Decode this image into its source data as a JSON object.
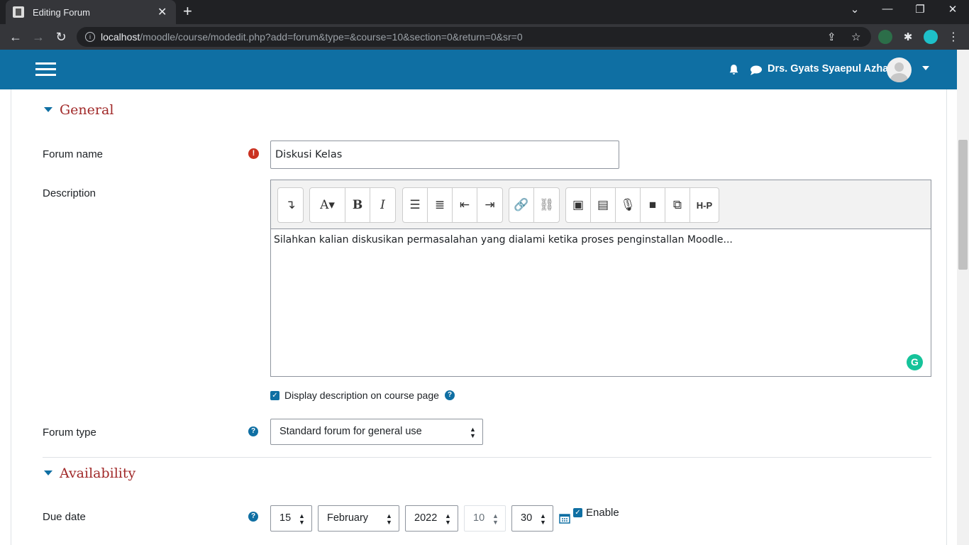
{
  "browser": {
    "tab_title": "Editing Forum",
    "url_host": "localhost",
    "url_path": "/moodle/course/modedit.php?add=forum&type=&course=10&section=0&return=0&sr=0"
  },
  "header": {
    "user_name": "Drs. Gyats Syaepul Azhar"
  },
  "general": {
    "heading": "General",
    "forum_name_label": "Forum name",
    "forum_name_value": "Diskusi Kelas",
    "description_label": "Description",
    "description_text": "Silahkan kalian diskusikan permasalahan yang dialami ketika proses penginstallan Moodle...",
    "display_desc_label": "Display description on course page",
    "forum_type_label": "Forum type",
    "forum_type_value": "Standard forum for general use"
  },
  "availability": {
    "heading": "Availability",
    "due_date_label": "Due date",
    "day": "15",
    "month": "February",
    "year": "2022",
    "hour": "10",
    "minute": "30",
    "enable_label": "Enable"
  },
  "toolbar": {
    "hp_label": "H-P"
  },
  "colors": {
    "header": "#0f6fa3",
    "heading": "#a12a2a",
    "required": "#ca3120"
  }
}
